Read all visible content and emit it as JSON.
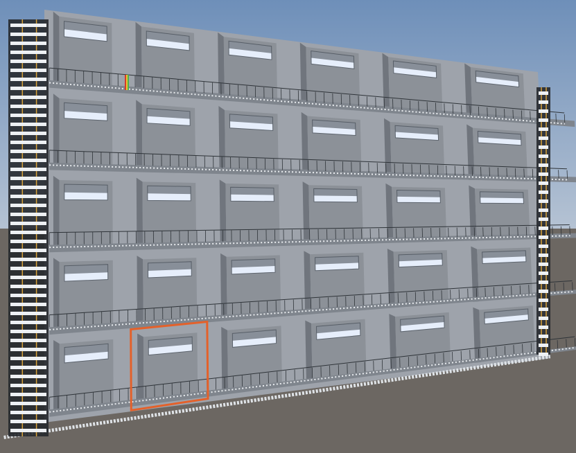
{
  "scene": {
    "sky_top_color": "#6e8fb9",
    "sky_bottom_color": "#b7c4d4",
    "ground_color": "#6c6762",
    "wall_color": "#9ea3ab",
    "mullion_color": "#8c9198",
    "recess_shadow_color": "#4a5058",
    "window_color": "#e6eefb",
    "slab_color": "#7f858d",
    "railing_color": "#2e3338",
    "scaffold_color": "#26292d",
    "scaffold_accent_color": "#d8a23a",
    "selection_color": "#e4612a",
    "marker_colors": [
      "#d33b2b",
      "#f1c232",
      "#4bb34b"
    ],
    "floors": 5,
    "bays": 6,
    "selected_window": {
      "floor": 5,
      "bay": 2
    }
  }
}
